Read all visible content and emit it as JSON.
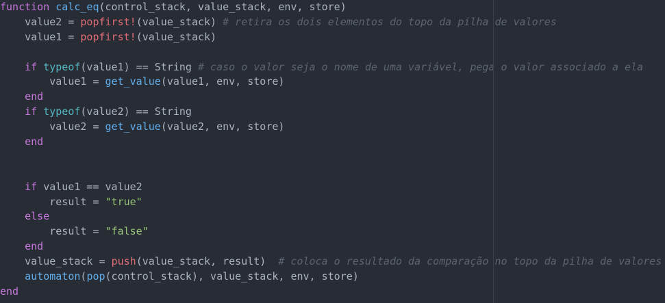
{
  "editor": {
    "background": "#282c34",
    "colors": {
      "kw": "#c678dd",
      "fn": "#61afef",
      "call": "#e06c75",
      "ty": "#56b6c2",
      "str": "#98c379",
      "cm": "#5c6370",
      "pl": "#abb2bf"
    },
    "lines": [
      [
        [
          "kw",
          "function"
        ],
        [
          "pl",
          " "
        ],
        [
          "fn",
          "calc_eq"
        ],
        [
          "pl",
          "(control_stack, value_stack, env, store)"
        ]
      ],
      [
        [
          "pl",
          "    value2 = "
        ],
        [
          "call",
          "popfirst!"
        ],
        [
          "pl",
          "(value_stack) "
        ],
        [
          "cm",
          "# retira os dois elementos do topo da pilha de valores"
        ]
      ],
      [
        [
          "pl",
          "    value1 = "
        ],
        [
          "call",
          "popfirst!"
        ],
        [
          "pl",
          "(value_stack)"
        ]
      ],
      [],
      [
        [
          "pl",
          "    "
        ],
        [
          "kw",
          "if"
        ],
        [
          "pl",
          " "
        ],
        [
          "ty",
          "typeof"
        ],
        [
          "pl",
          "(value1) == String "
        ],
        [
          "cm",
          "# caso o valor seja o nome de uma variável, pega o valor associado a ela"
        ]
      ],
      [
        [
          "pl",
          "        value1 = "
        ],
        [
          "fn",
          "get_value"
        ],
        [
          "pl",
          "(value1, env, store)"
        ]
      ],
      [
        [
          "pl",
          "    "
        ],
        [
          "kw",
          "end"
        ]
      ],
      [
        [
          "pl",
          "    "
        ],
        [
          "kw",
          "if"
        ],
        [
          "pl",
          " "
        ],
        [
          "ty",
          "typeof"
        ],
        [
          "pl",
          "(value2) == String"
        ]
      ],
      [
        [
          "pl",
          "        value2 = "
        ],
        [
          "fn",
          "get_value"
        ],
        [
          "pl",
          "(value2, env, store)"
        ]
      ],
      [
        [
          "pl",
          "    "
        ],
        [
          "kw",
          "end"
        ]
      ],
      [],
      [],
      [
        [
          "pl",
          "    "
        ],
        [
          "kw",
          "if"
        ],
        [
          "pl",
          " value1 == value2"
        ]
      ],
      [
        [
          "pl",
          "        result = "
        ],
        [
          "str",
          "\"true\""
        ]
      ],
      [
        [
          "pl",
          "    "
        ],
        [
          "kw",
          "else"
        ]
      ],
      [
        [
          "pl",
          "        result = "
        ],
        [
          "str",
          "\"false\""
        ]
      ],
      [
        [
          "pl",
          "    "
        ],
        [
          "kw",
          "end"
        ]
      ],
      [
        [
          "pl",
          "    value_stack = "
        ],
        [
          "call",
          "push"
        ],
        [
          "pl",
          "(value_stack, result)  "
        ],
        [
          "cm",
          "# coloca o resultado da comparação no topo da pilha de valores"
        ]
      ],
      [
        [
          "pl",
          "    "
        ],
        [
          "fn",
          "automaton"
        ],
        [
          "pl",
          "("
        ],
        [
          "fn",
          "pop"
        ],
        [
          "pl",
          "(control_stack), value_stack, env, store)"
        ]
      ],
      [
        [
          "kw",
          "end"
        ]
      ]
    ]
  }
}
